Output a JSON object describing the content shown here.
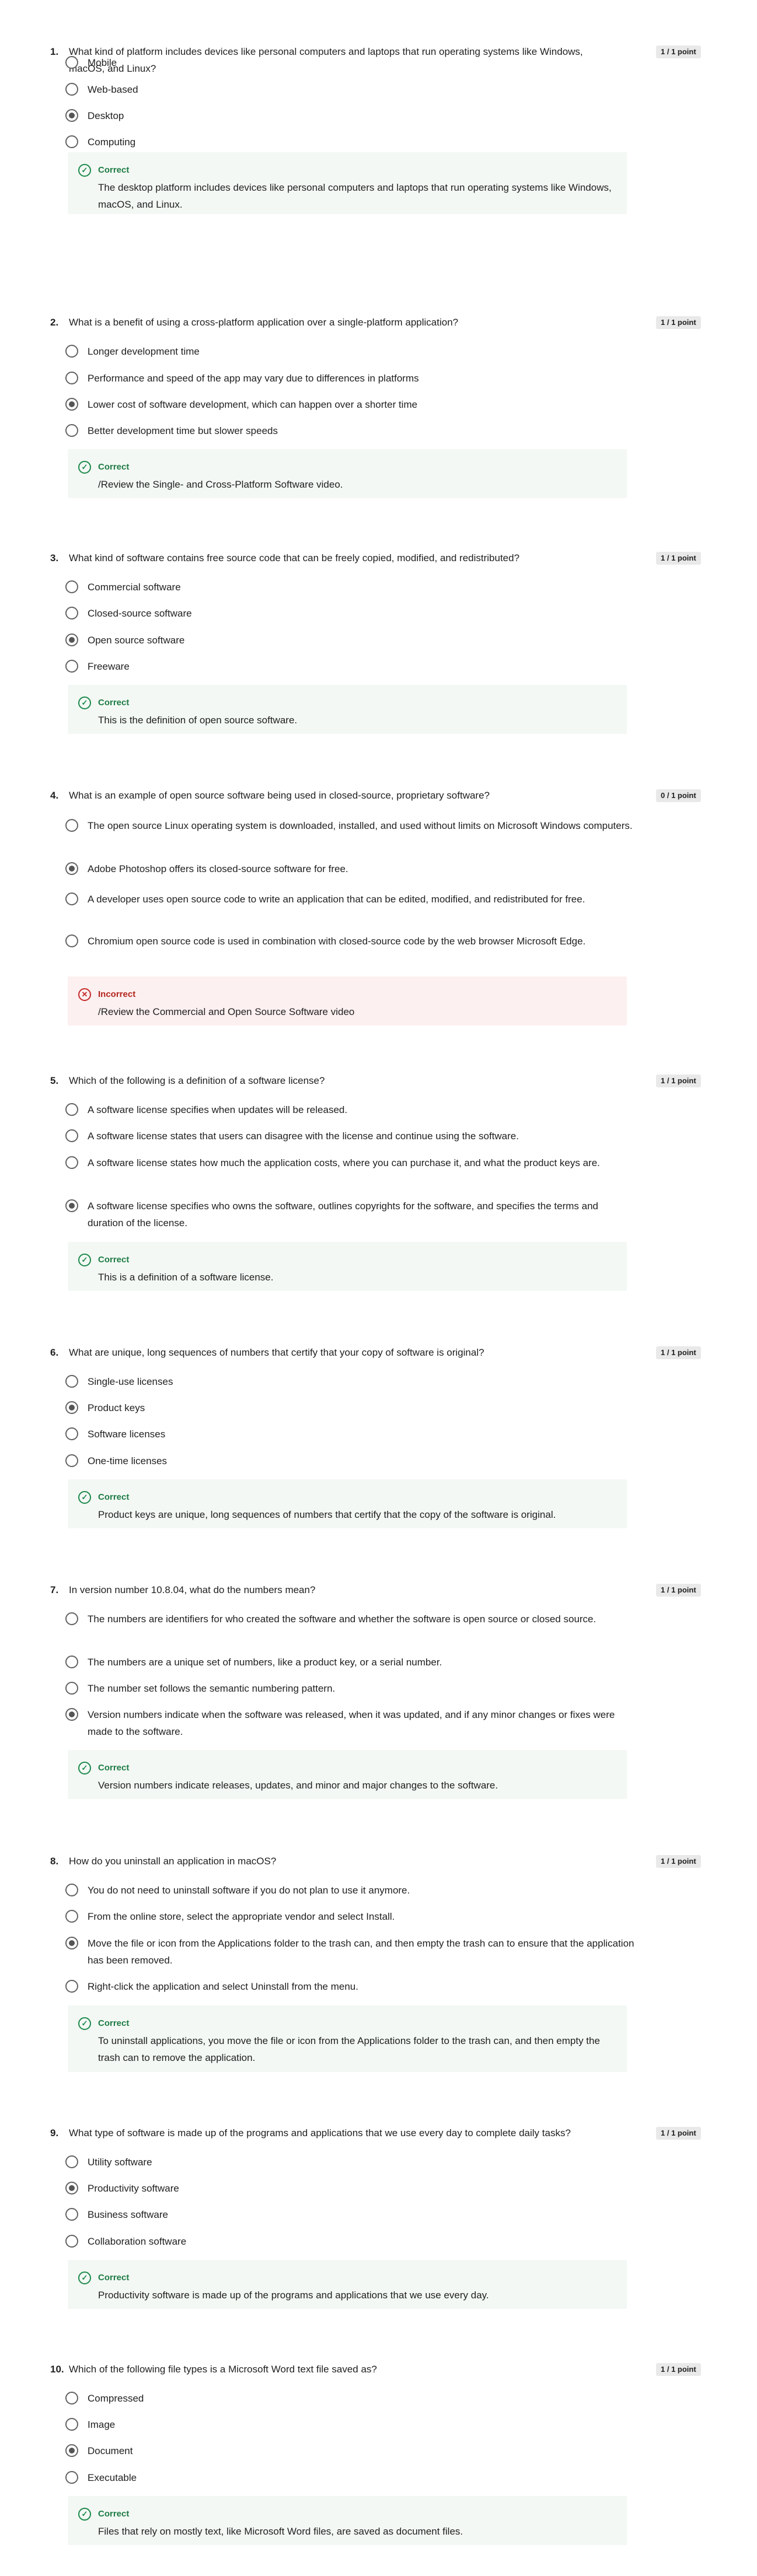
{
  "questions": [
    {
      "number": "1.",
      "text": "What kind of platform includes devices like personal computers and laptops that run operating systems like Windows, macOS, and Linux?",
      "points": "1 / 1 point",
      "options": [
        "Mobile",
        "Web-based",
        "Desktop",
        "Computing"
      ],
      "selected": 2,
      "feedback_status": "Correct",
      "feedback_text": "The desktop platform includes devices like personal computers and laptops that run operating systems like Windows, macOS, and Linux.",
      "result": "correct"
    },
    {
      "number": "2.",
      "text": "What is a benefit of using a cross-platform application over a single-platform application?",
      "points": "1 / 1 point",
      "options": [
        "Longer development time",
        "Performance and speed of the app may vary due to differences in platforms",
        "Lower cost of software development, which can happen over a shorter time",
        "Better development time but slower speeds"
      ],
      "selected": 2,
      "feedback_status": "Correct",
      "feedback_text": "/Review the Single- and Cross-Platform Software video.",
      "result": "correct"
    },
    {
      "number": "3.",
      "text": "What kind of software contains free source code that can be freely copied, modified, and redistributed?",
      "points": "1 / 1 point",
      "options": [
        "Commercial software",
        "Closed-source software",
        "Open source software",
        "Freeware"
      ],
      "selected": 2,
      "feedback_status": "Correct",
      "feedback_text": "This is the definition of open source software.",
      "result": "correct"
    },
    {
      "number": "4.",
      "text": "What is an example of open source software being used in closed-source, proprietary software?",
      "points": "0 / 1 point",
      "options": [
        "The open source Linux operating system is downloaded, installed, and used without limits on Microsoft Windows computers.",
        "Adobe Photoshop offers its closed-source software for free.",
        "A developer uses open source code to write an application that can be edited, modified, and redistributed for free.",
        "Chromium open source code is used in combination with closed-source code by the web browser Microsoft Edge."
      ],
      "selected": 1,
      "feedback_status": "Incorrect",
      "feedback_text": "/Review the Commercial and Open Source Software video",
      "result": "incorrect"
    },
    {
      "number": "5.",
      "text": "Which of the following is a definition of a software license?",
      "points": "1 / 1 point",
      "options": [
        "A software license specifies when updates will be released.",
        "A software license states that users can disagree with the license and continue using the software.",
        "A software license states how much the application costs, where you can purchase it, and what the product keys are.",
        "A software license specifies who owns the software, outlines copyrights for the software, and specifies the terms and duration of the license."
      ],
      "selected": 3,
      "feedback_status": "Correct",
      "feedback_text": "This is a definition of a software license.",
      "result": "correct"
    },
    {
      "number": "6.",
      "text": "What are unique, long sequences of numbers that certify that your copy of software is original?",
      "points": "1 / 1 point",
      "options": [
        "Single-use licenses",
        "Product keys",
        "Software licenses",
        "One-time licenses"
      ],
      "selected": 1,
      "feedback_status": "Correct",
      "feedback_text": "Product keys are unique, long sequences of numbers that certify that the copy of the software is original.",
      "result": "correct"
    },
    {
      "number": "7.",
      "text": "In version number 10.8.04, what do the numbers mean?",
      "points": "1 / 1 point",
      "options": [
        "The numbers are identifiers for who created the software and whether the software is open source or closed source.",
        "The numbers are a unique set of numbers, like a product key, or a serial number.",
        "The number set follows the semantic numbering pattern.",
        "Version numbers indicate when the software was released, when it was updated, and if any minor changes or fixes were made to the software."
      ],
      "selected": 3,
      "feedback_status": "Correct",
      "feedback_text": "Version numbers indicate releases, updates, and minor and major changes to the software.",
      "result": "correct"
    },
    {
      "number": "8.",
      "text": "How do you uninstall an application in macOS?",
      "points": "1 / 1 point",
      "options": [
        "You do not need to uninstall software if you do not plan to use it anymore.",
        "From the online store, select the appropriate vendor and select Install.",
        "Move the file or icon from the Applications folder to the trash can, and then empty the trash can to ensure that the application has been removed.",
        "Right-click the application and select Uninstall from the menu."
      ],
      "selected": 2,
      "feedback_status": "Correct",
      "feedback_text": "To uninstall applications, you move the file or icon from the Applications folder to the trash can, and then empty the trash can to remove the application.",
      "result": "correct"
    },
    {
      "number": "9.",
      "text": "What type of software is made up of the programs and applications that we use every day to complete daily tasks?",
      "points": "1 / 1 point",
      "options": [
        "Utility software",
        "Productivity software",
        "Business software",
        "Collaboration software"
      ],
      "selected": 1,
      "feedback_status": "Correct",
      "feedback_text": "Productivity software is made up of the programs and applications that we use every day.",
      "result": "correct"
    },
    {
      "number": "10.",
      "text": "Which of the following file types is a Microsoft Word text file saved as?",
      "points": "1 / 1 point",
      "options": [
        "Compressed",
        "Image",
        "Document",
        "Executable"
      ],
      "selected": 2,
      "feedback_status": "Correct",
      "feedback_text": "Files that rely on mostly text, like Microsoft Word files, are saved as document files.",
      "result": "correct"
    }
  ]
}
